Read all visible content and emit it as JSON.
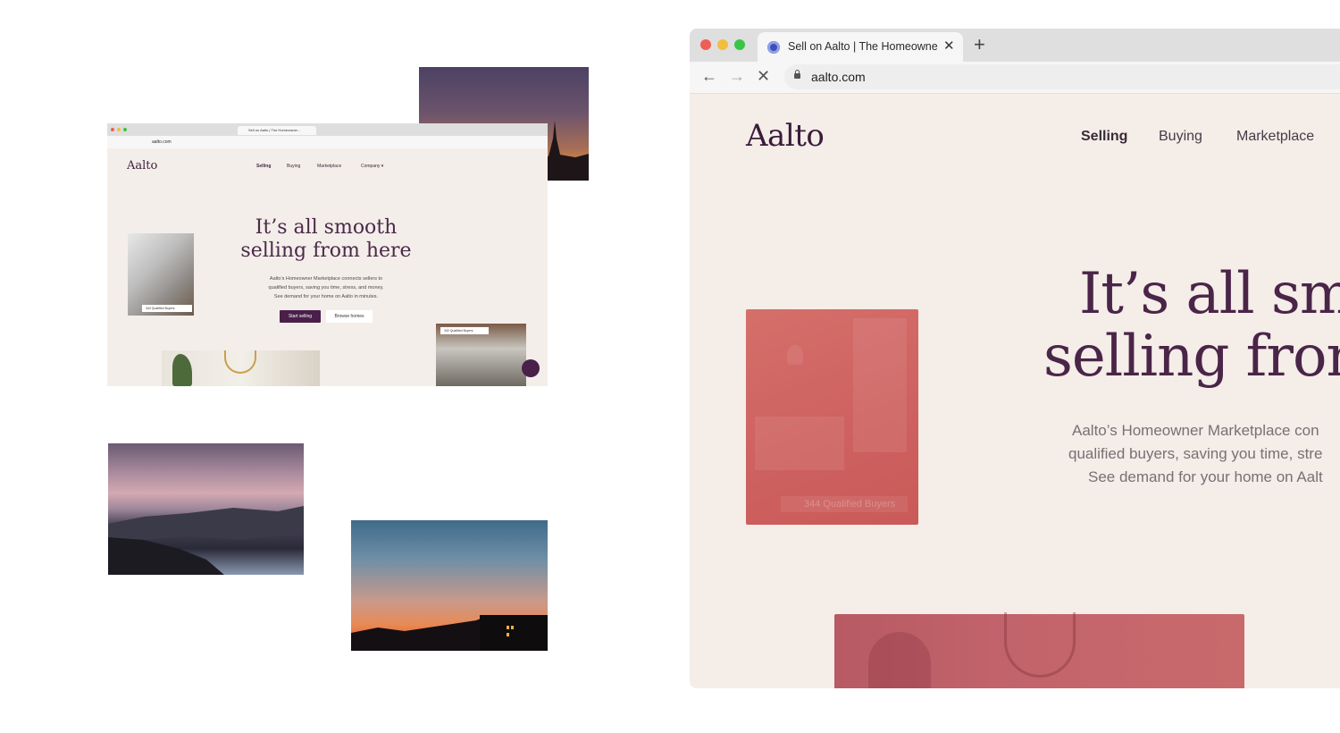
{
  "mini": {
    "tab_title": "Sell on Aalto | The Homeowner...",
    "url": "aalto.com",
    "logo": "Aalto",
    "nav": [
      "Selling",
      "Buying",
      "Marketplace",
      "Company ▾"
    ],
    "hero_line1": "It’s all smooth",
    "hero_line2": "selling from here",
    "hero_p1": "Aalto’s Homeowner Marketplace connects sellers to",
    "hero_p2": "qualified buyers, saving you time, stress, and money.",
    "hero_p3": "See demand for your home on Aalto in minutes.",
    "btn_start": "Start selling",
    "btn_browse": "Browse homes",
    "badge1": "344 Qualified Buyers",
    "badge2": "342 Qualified Buyers"
  },
  "browser": {
    "tab_title": "Sell on Aalto | The Homeowner",
    "new_tab": "+",
    "close": "✕",
    "url": "aalto.com",
    "back": "←",
    "forward": "→",
    "stop": "✕"
  },
  "site": {
    "logo": "Aalto",
    "nav": {
      "selling": "Selling",
      "buying": "Buying",
      "marketplace": "Marketplace"
    },
    "hero_line1": "It’s all smo",
    "hero_line2": "selling from",
    "hero_p1": "Aalto’s Homeowner Marketplace con",
    "hero_p2": "qualified buyers, saving you time, stre",
    "hero_p3": "See demand for your home on Aalt",
    "badge": "344 Qualified Buyers"
  },
  "colors": {
    "brand_purple": "#4a1f4a",
    "page_bg": "#f4ede8",
    "overlay_red": "#cf6462"
  }
}
